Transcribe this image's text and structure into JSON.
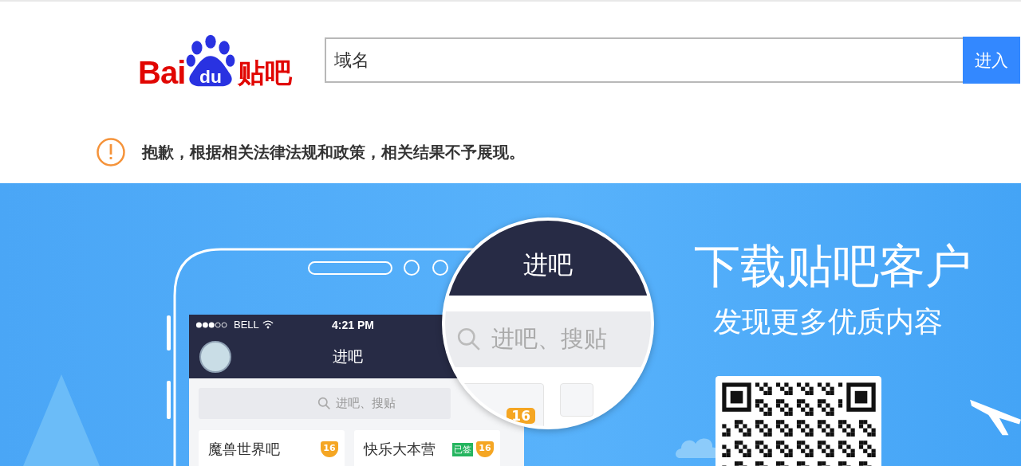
{
  "header": {
    "logo": {
      "left": "Bai",
      "paw": "du",
      "right": "贴吧"
    },
    "search": {
      "value": "域名"
    },
    "button": "进入"
  },
  "notice": {
    "text": "抱歉，根据相关法律法规和政策，相关结果不予展现。"
  },
  "banner": {
    "phone": {
      "carrier": "BELL",
      "time": "4:21 PM",
      "title": "进吧",
      "search_placeholder": "进吧、搜贴",
      "forums": [
        {
          "name": "魔兽世界吧",
          "level": "16"
        },
        {
          "name": "快乐大本营",
          "tag": "已签",
          "level": "16"
        }
      ]
    },
    "magnifier": {
      "title": "进吧",
      "search_placeholder": "进吧、搜贴",
      "level": "16"
    },
    "promo": {
      "title": "下载贴吧客户",
      "subtitle": "发现更多优质内容"
    }
  }
}
